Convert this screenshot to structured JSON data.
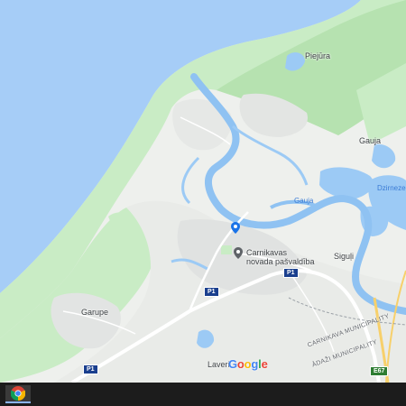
{
  "map": {
    "labels": {
      "piejura": "Piejūra",
      "gauja_area": "Gauja",
      "gauja_river": "Gauja",
      "dzirnezers": "Dzirnezer",
      "carnikavas": "Carnikavas",
      "novada": "novada pašvaldība",
      "siguli": "Siguļi",
      "garupe": "Garupe",
      "laveri": "Laveri",
      "carnikava_muni": "CARNIKAVA MUNICIPALITY",
      "adazi_muni": "ĀDAŽI MUNICIPALITY"
    },
    "road_shields": {
      "p1_a": "P1",
      "p1_b": "P1",
      "p1_c": "P1",
      "e67": "E67"
    },
    "colors": {
      "sea": "#a6cdf7",
      "forest": "#c9ecc5",
      "forest_dark": "#b6e2b0",
      "land": "#eef0ed",
      "urban": "#e2e4e3",
      "water": "#9ccaf5",
      "river": "#8fc2f2",
      "road": "#ffffff",
      "highway": "#f7d06b"
    },
    "icons": {
      "location_pin": "place-pin-icon",
      "poi": "municipality-poi-icon"
    }
  },
  "google": {
    "letters": [
      "G",
      "o",
      "o",
      "g",
      "l",
      "e"
    ],
    "colors": [
      "#4285F4",
      "#EA4335",
      "#FBBC05",
      "#4285F4",
      "#34A853",
      "#EA4335"
    ]
  },
  "taskbar": {
    "app_icon": "chrome-icon"
  }
}
